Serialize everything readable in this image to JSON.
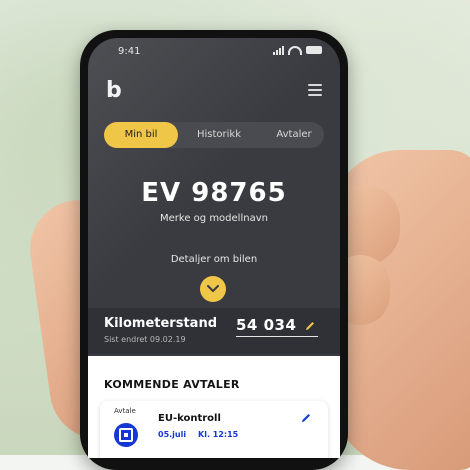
{
  "status": {
    "time": "9:41"
  },
  "app": {
    "logo": "b"
  },
  "tabs": [
    {
      "label": "Min bil",
      "active": true
    },
    {
      "label": "Historikk",
      "active": false
    },
    {
      "label": "Avtaler",
      "active": false
    }
  ],
  "car": {
    "plate": "EV 98765",
    "model": "Merke og modellnavn",
    "details_label": "Detaljer om bilen"
  },
  "odometer": {
    "label": "Kilometerstand",
    "last_changed": "Sist endret 09.02.19",
    "value": "54 034"
  },
  "upcoming": {
    "header": "KOMMENDE AVTALER",
    "items": [
      {
        "tag": "Avtale",
        "title": "EU-kontroll",
        "date": "05.juli",
        "time": "Kl. 12:15"
      }
    ]
  },
  "colors": {
    "accent": "#f0c648",
    "primary_blue": "#1437d6",
    "screen_bg": "#3a3b40"
  },
  "icons": [
    "hamburger-menu-icon",
    "chevron-down-icon",
    "pencil-icon",
    "calendar-icon",
    "signal-icon",
    "wifi-icon",
    "battery-icon"
  ]
}
